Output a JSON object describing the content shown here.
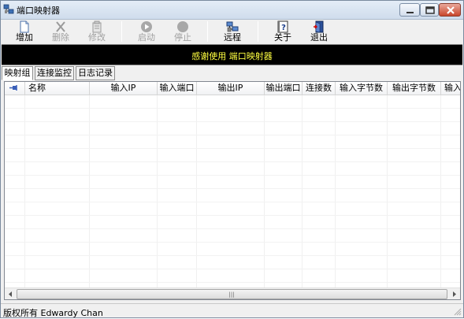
{
  "window": {
    "title": "端口映射器"
  },
  "toolbar": {
    "add": "增加",
    "delete": "删除",
    "modify": "修改",
    "start": "启动",
    "stop": "停止",
    "remote": "远程",
    "about": "关于",
    "exit": "退出"
  },
  "banner": {
    "text": "感谢使用 端口映射器"
  },
  "tabs": [
    "映射组",
    "连接监控",
    "日志记录"
  ],
  "table": {
    "columns": [
      "名称",
      "输入IP",
      "输入端口",
      "输出IP",
      "输出端口",
      "连接数",
      "输入字节数",
      "输出字节数",
      "输入"
    ],
    "rows": []
  },
  "status": {
    "text": "版权所有 Edwardy Chan"
  },
  "colors": {
    "banner_bg": "#000000",
    "banner_text": "#ffff40",
    "close_button": "#c9462c"
  }
}
